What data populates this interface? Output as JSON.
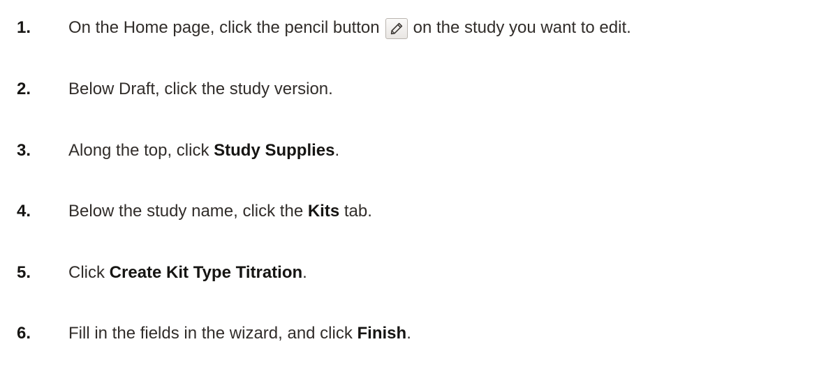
{
  "steps": [
    {
      "number": "1.",
      "parts": [
        "On the Home page, click the pencil button",
        "on the study you want to edit."
      ],
      "icon": "pencil-icon"
    },
    {
      "number": "2.",
      "text": "Below Draft, click the study version."
    },
    {
      "number": "3.",
      "before": "Along the top, click ",
      "bold": "Study Supplies",
      "after": "."
    },
    {
      "number": "4.",
      "before": "Below the study name, click the ",
      "bold": "Kits",
      "after": " tab."
    },
    {
      "number": "5.",
      "before": "Click ",
      "bold": "Create Kit Type Titration",
      "after": "."
    },
    {
      "number": "6.",
      "before": "Fill in the fields in the wizard, and click ",
      "bold": "Finish",
      "after": "."
    }
  ]
}
